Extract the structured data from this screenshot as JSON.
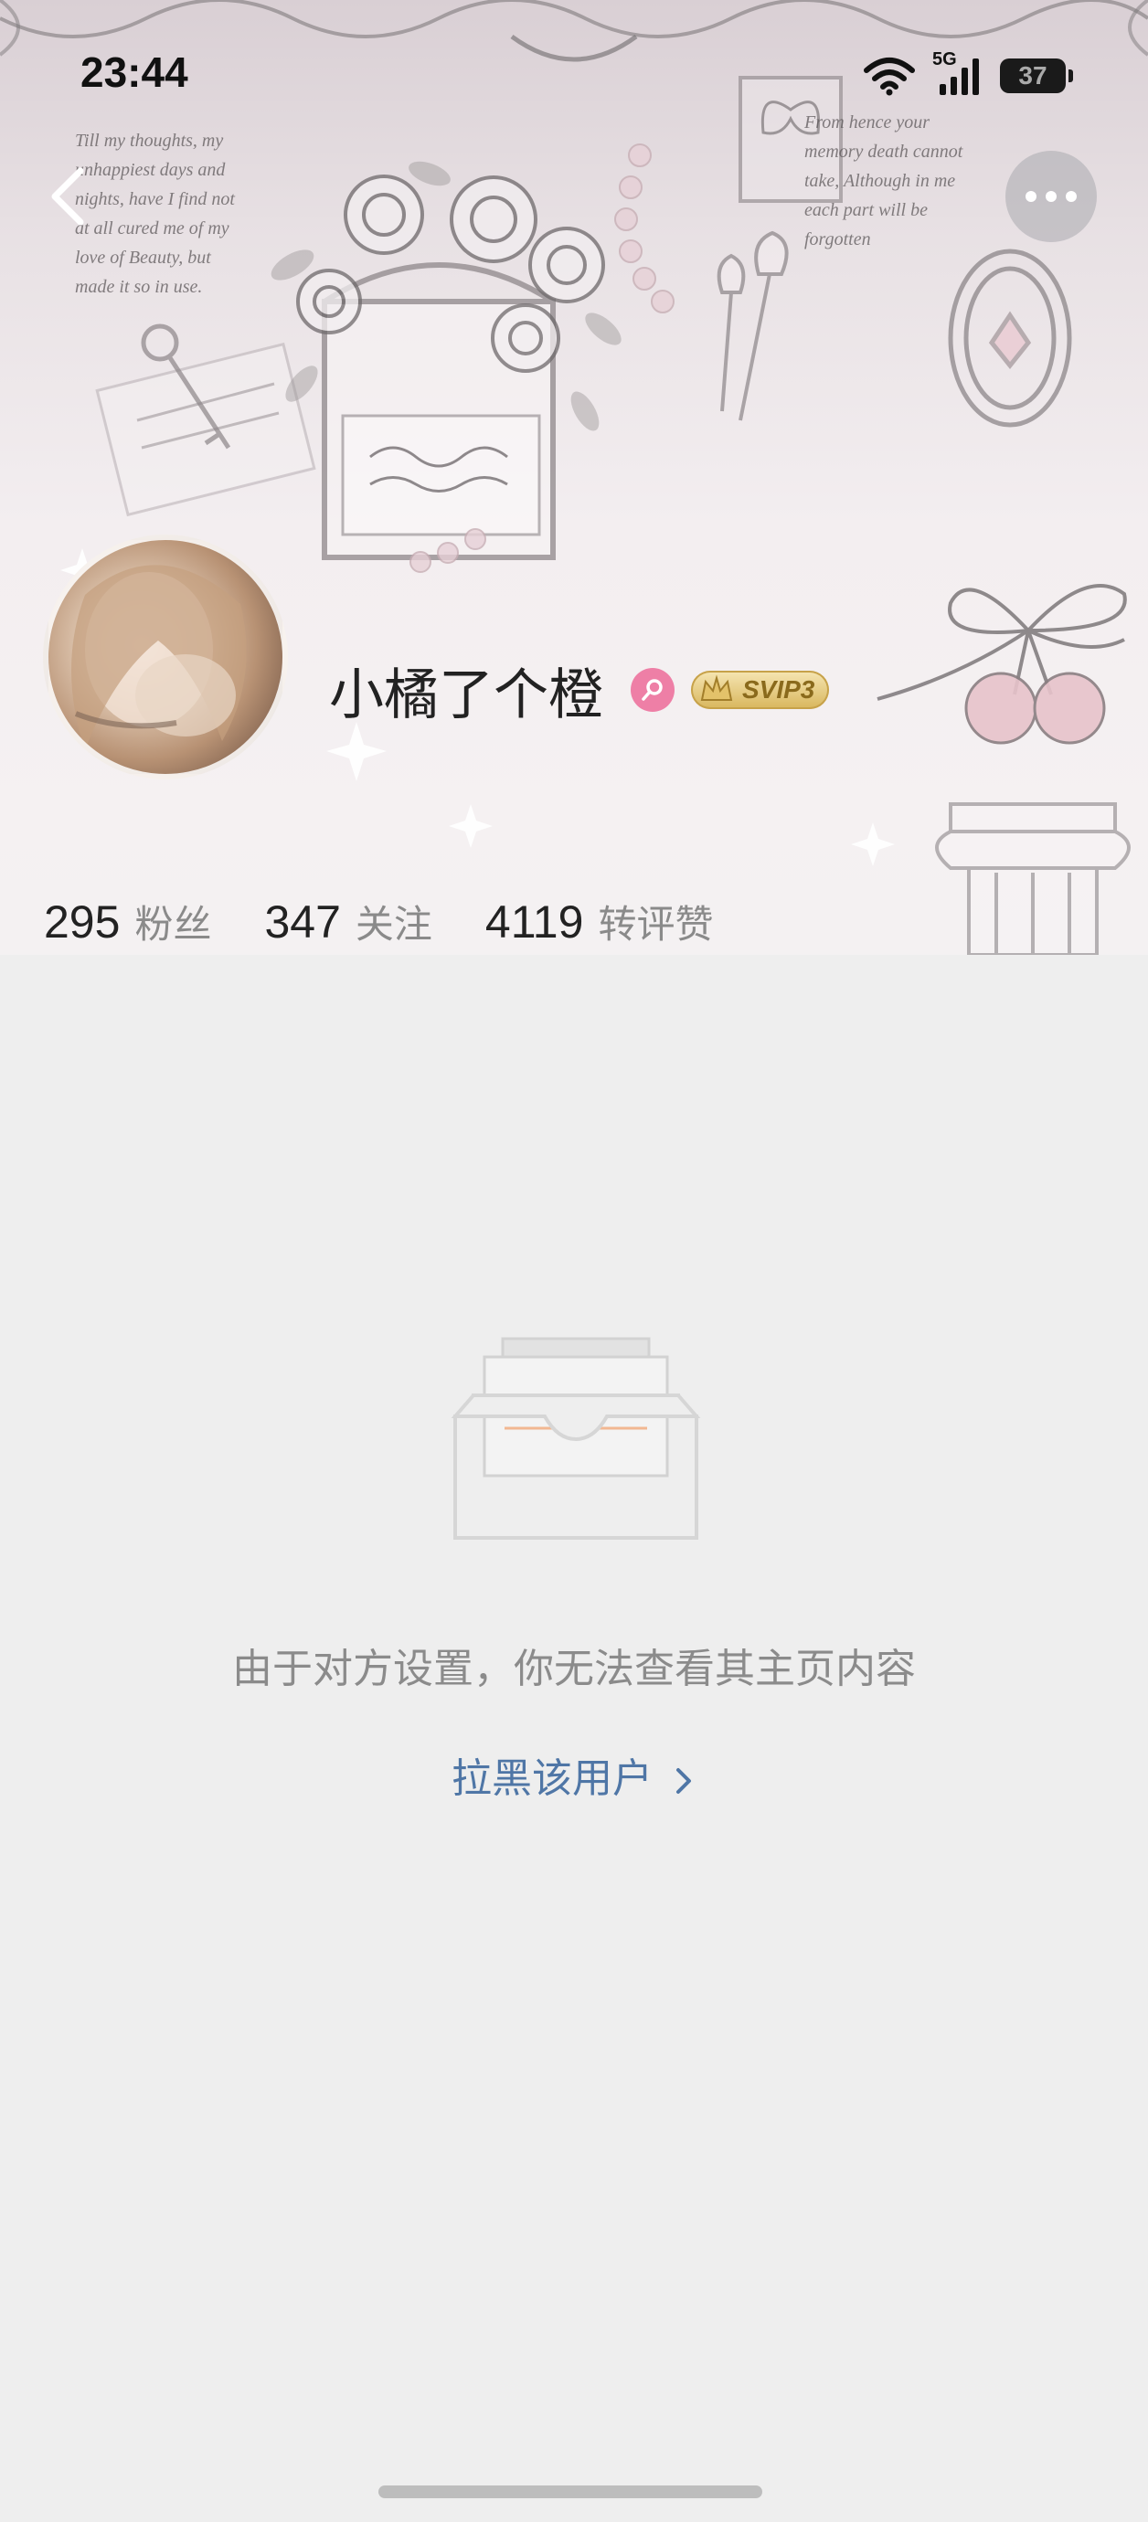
{
  "status_bar": {
    "time": "23:44",
    "network": "5G",
    "battery": "37",
    "icons": [
      "wifi-icon",
      "cellular-signal-icon",
      "battery-icon"
    ]
  },
  "nav": {
    "back_icon": "chevron-left-icon",
    "more_icon": "more-horizontal-icon"
  },
  "profile": {
    "username": "小橘了个橙",
    "gender_icon": "female-icon",
    "vip_badge": "SVIP3",
    "stats": [
      {
        "value": "295",
        "label": "粉丝"
      },
      {
        "value": "347",
        "label": "关注"
      },
      {
        "value": "4119",
        "label": "转评赞"
      }
    ]
  },
  "cover_text": {
    "left_poem": [
      "Till my thoughts, my",
      "unhappiest days and",
      "nights, have I find not",
      "at all cured me of my",
      "love of Beauty, but",
      "made it so in use."
    ],
    "right_poem": [
      "From hence your",
      "memory death cannot",
      "take, Although in me",
      "each part will be",
      "forgotten"
    ]
  },
  "content": {
    "empty_message": "由于对方设置，你无法查看其主页内容",
    "block_link": "拉黑该用户",
    "block_link_icon": "chevron-right-icon",
    "illustration": "empty-inbox-icon"
  },
  "colors": {
    "page_background": "#eeeeee",
    "link": "#4f76a6",
    "gender_badge": "#ee7fa6",
    "empty_text": "#8b8b8b"
  }
}
